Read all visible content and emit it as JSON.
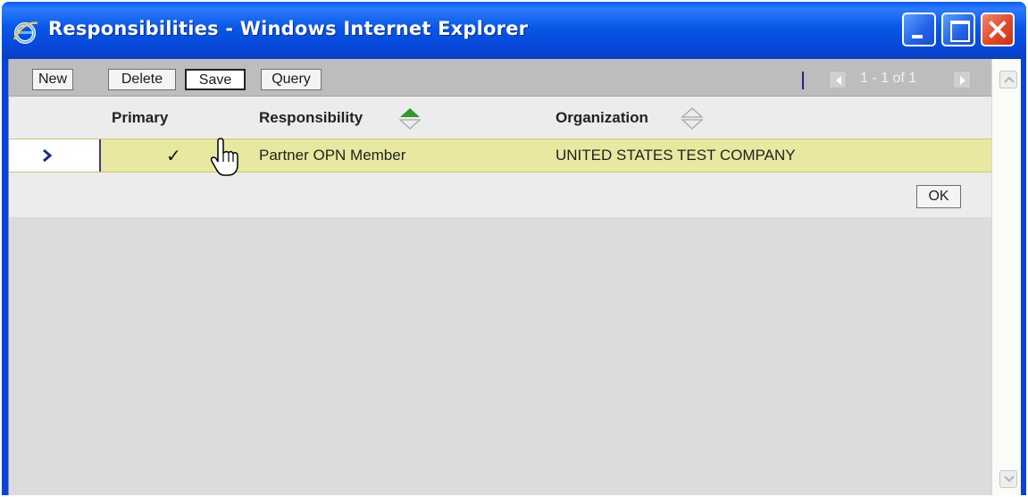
{
  "window": {
    "title": "Responsibilities - Windows Internet Explorer",
    "accent": "#0a57e6"
  },
  "toolbar": {
    "new_label": "New",
    "delete_label": "Delete",
    "save_label": "Save",
    "query_label": "Query",
    "pager_text": "1 - 1 of 1"
  },
  "table": {
    "columns": {
      "primary": "Primary",
      "responsibility": "Responsibility",
      "organization": "Organization"
    },
    "rows": [
      {
        "primary": "✓",
        "responsibility": "Partner OPN Member",
        "organization": "UNITED STATES TEST COMPANY"
      }
    ],
    "selected_row_color": "#e8e8a0"
  },
  "footer": {
    "ok_label": "OK"
  },
  "icons": {
    "browser": "internet-explorer-icon",
    "sort_active": "sort-asc-icon",
    "sort_inactive": "sort-icon",
    "row_marker": "chevron-right-icon"
  }
}
